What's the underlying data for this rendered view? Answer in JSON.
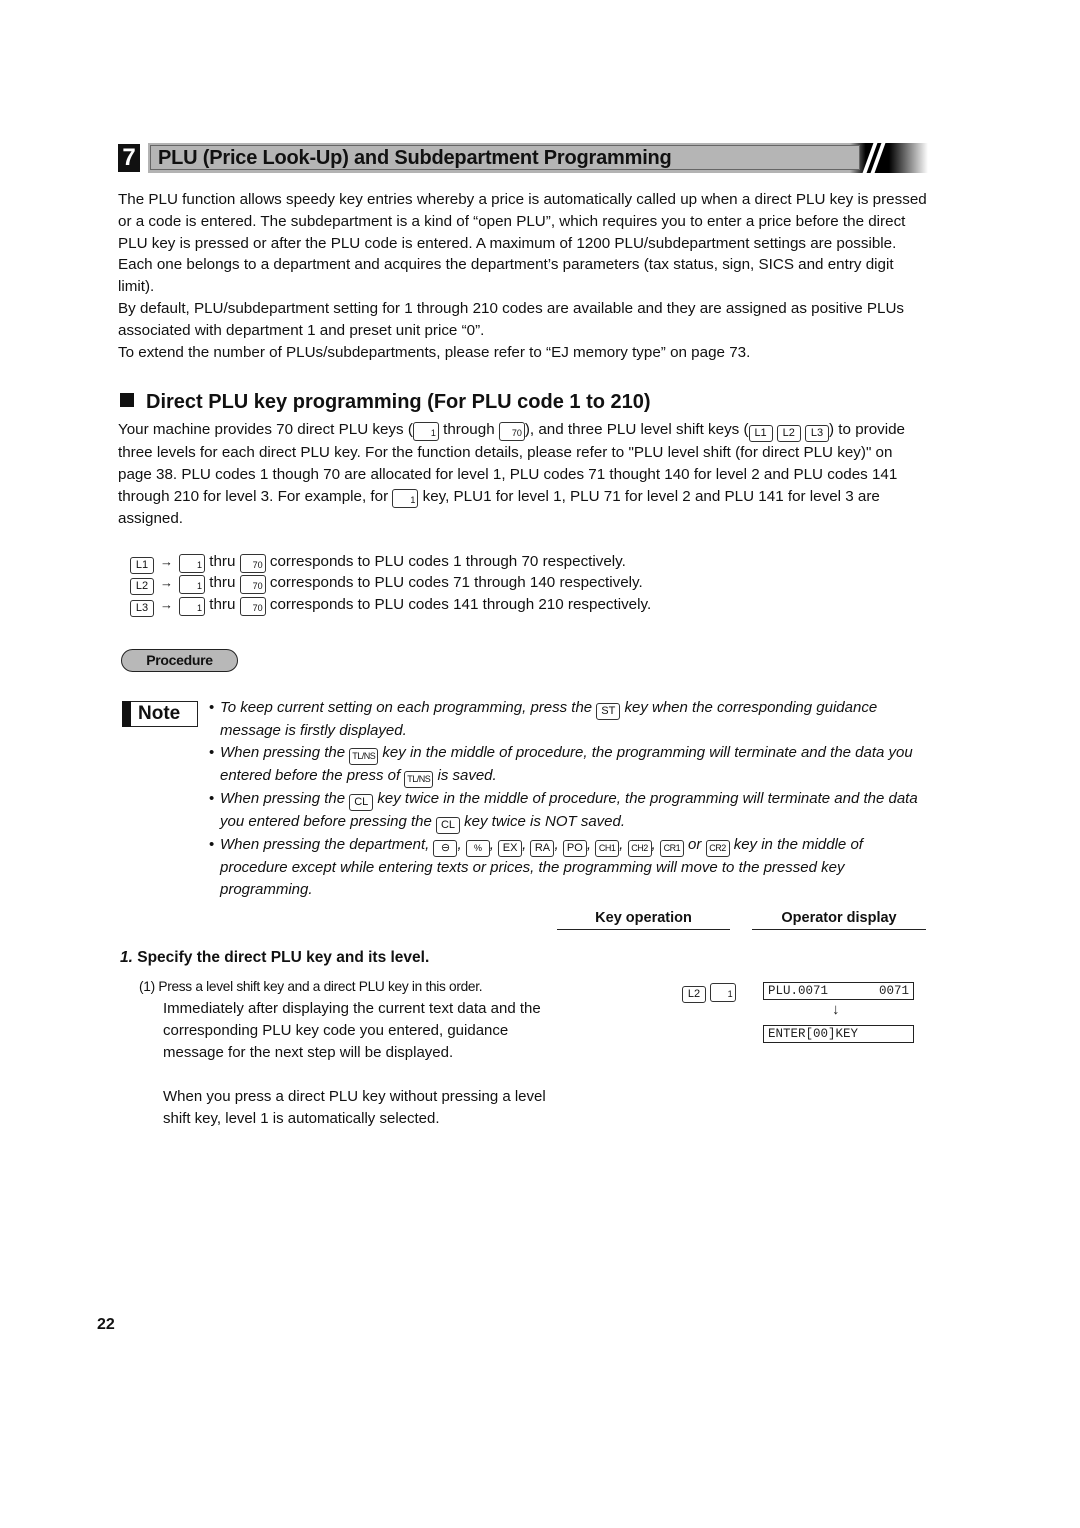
{
  "section": {
    "number": "7",
    "title": "PLU (Price Look-Up) and Subdepartment Programming"
  },
  "intro": [
    "The PLU function allows speedy key entries whereby a price is automatically called up when a direct PLU key is pressed or a code is entered.  The subdepartment is a kind of “open PLU”, which requires you to enter a price before the direct PLU key is pressed or after the PLU code is entered.  A maximum of 1200 PLU/subdepartment settings are possible. Each one belongs to a department and acquires the department’s parameters (tax status, sign, SICS and entry digit limit).",
    "By default, PLU/subdepartment setting for 1 through 210 codes are available and they are assigned as positive PLUs associated with department 1 and preset unit price “0”.",
    "To extend the number of PLUs/subdepartments, please refer to “EJ memory type” on page 73."
  ],
  "direct": {
    "heading": "Direct PLU key programming (For PLU code 1 to 210)",
    "p1": "Your machine provides 70 direct PLU keys (",
    "p2": " through ",
    "p3": "), and three PLU level shift keys (",
    "p4": ") to provide three levels for each direct PLU key.  For the function details, please refer to \"PLU level shift (for direct PLU key)\" on page 38.  PLU codes 1 though 70 are allocated for level 1, PLU codes 71 thought 140 for level 2 and PLU codes 141 through 210 for level 3.  For example, for ",
    "p5": " key, PLU1 for level 1, PLU 71 for level 2 and PLU 141 for level 3 are assigned.",
    "keys": {
      "first": "1",
      "last": "70",
      "l1": "L1",
      "l2": "L2",
      "l3": "L3"
    },
    "mapping": [
      {
        "shift": "L1",
        "from": "1",
        "thru": "thru",
        "to": "70",
        "text": "corresponds to PLU codes 1 through 70 respectively."
      },
      {
        "shift": "L2",
        "from": "1",
        "thru": "thru",
        "to": "70",
        "text": "corresponds to PLU codes 71 through 140 respectively."
      },
      {
        "shift": "L3",
        "from": "1",
        "thru": "thru",
        "to": "70",
        "text": "corresponds to PLU codes 141 through 210 respectively."
      }
    ],
    "arrow": "→"
  },
  "procedure_label": "Procedure",
  "note": {
    "label": "Note",
    "items": [
      {
        "a": "To keep current setting on each programming, press the ",
        "k1": "ST",
        "b": " key when the corresponding guidance message is firstly displayed."
      },
      {
        "a": "When pressing the ",
        "k1": "TL/NS",
        "b": " key in the middle of procedure, the programming will terminate and the data you entered before the press of ",
        "k2": "TL/NS",
        "c": " is saved."
      },
      {
        "a": "When pressing the ",
        "k1": "CL",
        "b": " key twice in the middle of procedure, the programming will terminate and the data you entered before pressing the ",
        "k2": "CL",
        "c": " key twice is NOT saved."
      },
      {
        "a": "When pressing the department, ",
        "keys": [
          "⊖",
          "%",
          "EX",
          "RA",
          "PO",
          "CH1",
          "CH2",
          "CR1",
          "CR2"
        ],
        "sep": ", ",
        "or": " or ",
        "b": " key in the middle of procedure except while entering texts or prices, the programming will move to the pressed key programming."
      }
    ]
  },
  "columns": {
    "key_operation": "Key operation",
    "operator_display": "Operator display"
  },
  "step1": {
    "number": "1.",
    "title": "Specify the direct PLU key and its level.",
    "sub_number": "(1)",
    "line1": "Press a level shift key and a direct PLU key in this order.",
    "body": "Immediately after displaying the current text data and the corresponding PLU key code you entered, guidance message for the next step will be displayed.",
    "note": "When you press a direct PLU key without pressing a level shift key, level 1 is automatically selected.",
    "key_sequence": [
      "L2",
      "1"
    ],
    "display1": {
      "left": "PLU.0071",
      "right": "0071"
    },
    "display_arrow": "↓",
    "display2": "ENTER[00]KEY"
  },
  "page_number": "22"
}
